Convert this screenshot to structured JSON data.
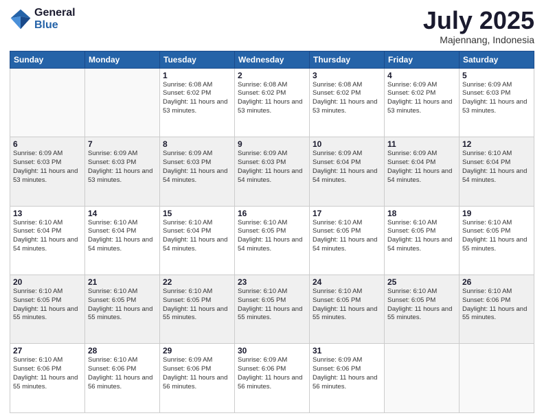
{
  "logo": {
    "line1": "General",
    "line2": "Blue"
  },
  "title": "July 2025",
  "subtitle": "Majennang, Indonesia",
  "days": [
    "Sunday",
    "Monday",
    "Tuesday",
    "Wednesday",
    "Thursday",
    "Friday",
    "Saturday"
  ],
  "weeks": [
    [
      {
        "day": "",
        "info": ""
      },
      {
        "day": "",
        "info": ""
      },
      {
        "day": "1",
        "info": "Sunrise: 6:08 AM\nSunset: 6:02 PM\nDaylight: 11 hours and 53 minutes."
      },
      {
        "day": "2",
        "info": "Sunrise: 6:08 AM\nSunset: 6:02 PM\nDaylight: 11 hours and 53 minutes."
      },
      {
        "day": "3",
        "info": "Sunrise: 6:08 AM\nSunset: 6:02 PM\nDaylight: 11 hours and 53 minutes."
      },
      {
        "day": "4",
        "info": "Sunrise: 6:09 AM\nSunset: 6:02 PM\nDaylight: 11 hours and 53 minutes."
      },
      {
        "day": "5",
        "info": "Sunrise: 6:09 AM\nSunset: 6:03 PM\nDaylight: 11 hours and 53 minutes."
      }
    ],
    [
      {
        "day": "6",
        "info": "Sunrise: 6:09 AM\nSunset: 6:03 PM\nDaylight: 11 hours and 53 minutes."
      },
      {
        "day": "7",
        "info": "Sunrise: 6:09 AM\nSunset: 6:03 PM\nDaylight: 11 hours and 53 minutes."
      },
      {
        "day": "8",
        "info": "Sunrise: 6:09 AM\nSunset: 6:03 PM\nDaylight: 11 hours and 54 minutes."
      },
      {
        "day": "9",
        "info": "Sunrise: 6:09 AM\nSunset: 6:03 PM\nDaylight: 11 hours and 54 minutes."
      },
      {
        "day": "10",
        "info": "Sunrise: 6:09 AM\nSunset: 6:04 PM\nDaylight: 11 hours and 54 minutes."
      },
      {
        "day": "11",
        "info": "Sunrise: 6:09 AM\nSunset: 6:04 PM\nDaylight: 11 hours and 54 minutes."
      },
      {
        "day": "12",
        "info": "Sunrise: 6:10 AM\nSunset: 6:04 PM\nDaylight: 11 hours and 54 minutes."
      }
    ],
    [
      {
        "day": "13",
        "info": "Sunrise: 6:10 AM\nSunset: 6:04 PM\nDaylight: 11 hours and 54 minutes."
      },
      {
        "day": "14",
        "info": "Sunrise: 6:10 AM\nSunset: 6:04 PM\nDaylight: 11 hours and 54 minutes."
      },
      {
        "day": "15",
        "info": "Sunrise: 6:10 AM\nSunset: 6:04 PM\nDaylight: 11 hours and 54 minutes."
      },
      {
        "day": "16",
        "info": "Sunrise: 6:10 AM\nSunset: 6:05 PM\nDaylight: 11 hours and 54 minutes."
      },
      {
        "day": "17",
        "info": "Sunrise: 6:10 AM\nSunset: 6:05 PM\nDaylight: 11 hours and 54 minutes."
      },
      {
        "day": "18",
        "info": "Sunrise: 6:10 AM\nSunset: 6:05 PM\nDaylight: 11 hours and 54 minutes."
      },
      {
        "day": "19",
        "info": "Sunrise: 6:10 AM\nSunset: 6:05 PM\nDaylight: 11 hours and 55 minutes."
      }
    ],
    [
      {
        "day": "20",
        "info": "Sunrise: 6:10 AM\nSunset: 6:05 PM\nDaylight: 11 hours and 55 minutes."
      },
      {
        "day": "21",
        "info": "Sunrise: 6:10 AM\nSunset: 6:05 PM\nDaylight: 11 hours and 55 minutes."
      },
      {
        "day": "22",
        "info": "Sunrise: 6:10 AM\nSunset: 6:05 PM\nDaylight: 11 hours and 55 minutes."
      },
      {
        "day": "23",
        "info": "Sunrise: 6:10 AM\nSunset: 6:05 PM\nDaylight: 11 hours and 55 minutes."
      },
      {
        "day": "24",
        "info": "Sunrise: 6:10 AM\nSunset: 6:05 PM\nDaylight: 11 hours and 55 minutes."
      },
      {
        "day": "25",
        "info": "Sunrise: 6:10 AM\nSunset: 6:05 PM\nDaylight: 11 hours and 55 minutes."
      },
      {
        "day": "26",
        "info": "Sunrise: 6:10 AM\nSunset: 6:06 PM\nDaylight: 11 hours and 55 minutes."
      }
    ],
    [
      {
        "day": "27",
        "info": "Sunrise: 6:10 AM\nSunset: 6:06 PM\nDaylight: 11 hours and 55 minutes."
      },
      {
        "day": "28",
        "info": "Sunrise: 6:10 AM\nSunset: 6:06 PM\nDaylight: 11 hours and 56 minutes."
      },
      {
        "day": "29",
        "info": "Sunrise: 6:09 AM\nSunset: 6:06 PM\nDaylight: 11 hours and 56 minutes."
      },
      {
        "day": "30",
        "info": "Sunrise: 6:09 AM\nSunset: 6:06 PM\nDaylight: 11 hours and 56 minutes."
      },
      {
        "day": "31",
        "info": "Sunrise: 6:09 AM\nSunset: 6:06 PM\nDaylight: 11 hours and 56 minutes."
      },
      {
        "day": "",
        "info": ""
      },
      {
        "day": "",
        "info": ""
      }
    ]
  ]
}
